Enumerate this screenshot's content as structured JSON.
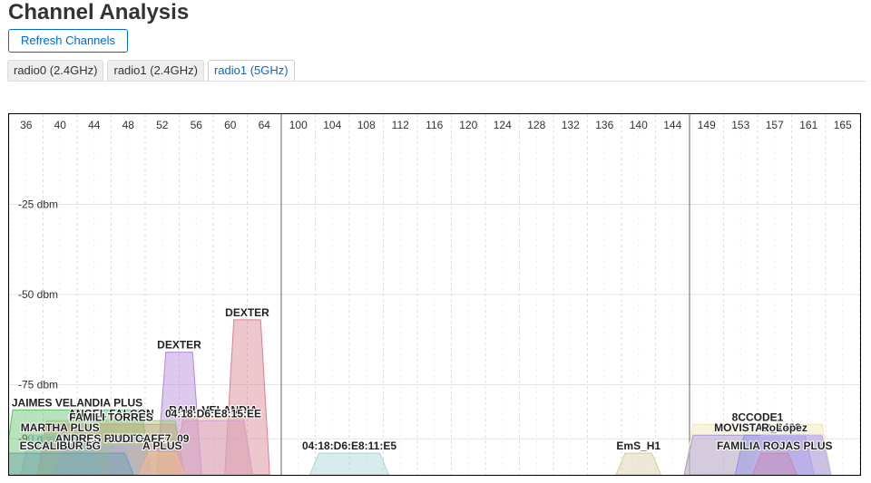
{
  "page": {
    "title": "Channel Analysis"
  },
  "toolbar": {
    "refresh_label": "Refresh Channels"
  },
  "tabs": [
    {
      "label": "radio0 (2.4GHz)",
      "active": false
    },
    {
      "label": "radio1 (2.4GHz)",
      "active": false
    },
    {
      "label": "radio1 (5GHz)",
      "active": true
    }
  ],
  "chart_data": {
    "type": "area",
    "x_ticks": [
      "36",
      "40",
      "44",
      "48",
      "52",
      "56",
      "60",
      "64",
      "100",
      "104",
      "108",
      "112",
      "116",
      "120",
      "124",
      "128",
      "132",
      "136",
      "140",
      "144",
      "149",
      "153",
      "157",
      "161",
      "165"
    ],
    "y_ticks": [
      "-25 dbm",
      "-50 dbm",
      "-75 dbm",
      "-90 dbm"
    ],
    "y_tick_values": [
      -25,
      -50,
      -75,
      -90
    ],
    "ylim": [
      -100,
      0
    ],
    "networks": [
      {
        "ssid": "DEXTER",
        "channel": 62,
        "width": 20,
        "signal": -57,
        "color": "#d98090"
      },
      {
        "ssid": "DEXTER",
        "channel": 54,
        "width": 20,
        "signal": -66,
        "color": "#b388d8"
      },
      {
        "ssid": "JAIMES VELANDIA PLUS",
        "channel": 42,
        "width": 80,
        "signal": -82,
        "color": "#5fbf6a"
      },
      {
        "ssid": "ANGEL FALCON",
        "channel": 46,
        "width": 80,
        "signal": -85,
        "color": "#9ec78a"
      },
      {
        "ssid": "FAMILI TORRES",
        "channel": 46,
        "width": 80,
        "signal": -86,
        "color": "#c8a878"
      },
      {
        "ssid": "RAUL VELANDIA",
        "channel": 58,
        "width": 40,
        "signal": -84,
        "color": "#e8b0a0"
      },
      {
        "ssid": "04:18:D6:E8:15:EE",
        "channel": 58,
        "width": 40,
        "signal": -85,
        "color": "#d6a0c8"
      },
      {
        "ssid": "MARTHA PLUS",
        "channel": 40,
        "width": 40,
        "signal": -89,
        "color": "#8fc8b0"
      },
      {
        "ssid": "ANDRES PLUS",
        "channel": 44,
        "width": 40,
        "signal": -92,
        "color": "#a0b0d8"
      },
      {
        "ssid": "JUDITH",
        "channel": 48,
        "width": 20,
        "signal": -92,
        "color": "#c0a8e0"
      },
      {
        "ssid": "CAFE7_09",
        "channel": 52,
        "width": 20,
        "signal": -92,
        "color": "#e0a0b8"
      },
      {
        "ssid": "A PLUS",
        "channel": 52,
        "width": 20,
        "signal": -94,
        "color": "#f0c090"
      },
      {
        "ssid": "ESCALIBUR 5G",
        "channel": 40,
        "width": 80,
        "signal": -94,
        "color": "#6fa0a8"
      },
      {
        "ssid": "04:18:D6:E8:11:E5",
        "channel": 106,
        "width": 40,
        "signal": -94,
        "color": "#a8d4d8"
      },
      {
        "ssid": "EmS_H1",
        "channel": 140,
        "width": 20,
        "signal": -94,
        "color": "#d8cca8"
      },
      {
        "ssid": "8CCODE1",
        "channel": 155,
        "width": 80,
        "signal": -86,
        "color": "#f0e6b0"
      },
      {
        "ssid": "MOVISTAR_6488",
        "channel": 155,
        "width": 80,
        "signal": -89,
        "color": "#a898e0"
      },
      {
        "ssid": "Rosa",
        "channel": 157,
        "width": 40,
        "signal": -89,
        "color": "#9090e8"
      },
      {
        "ssid": "Lopez",
        "channel": 159,
        "width": 40,
        "signal": -89,
        "color": "#c4b4f0"
      },
      {
        "ssid": "FAMILIA ROJAS PLUS",
        "channel": 157,
        "width": 20,
        "signal": -94,
        "color": "#c888b0"
      }
    ]
  }
}
